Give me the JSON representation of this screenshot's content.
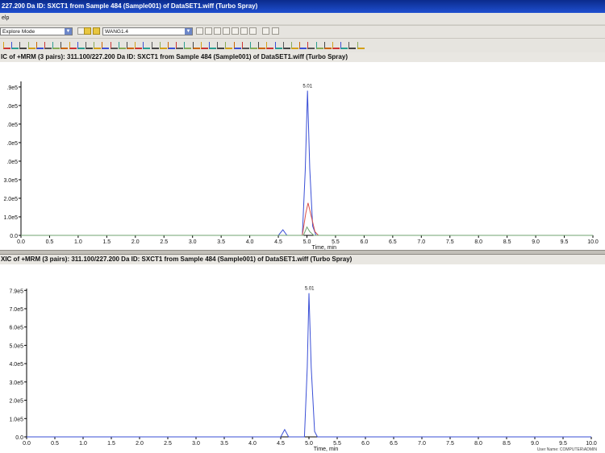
{
  "window": {
    "title": "227.200 Da ID: SXCT1 from Sample 484 (Sample001) of DataSET1.wiff (Turbo Spray)"
  },
  "menu": {
    "label": "elp"
  },
  "toolbar": {
    "mode_select": "Explore Mode",
    "dataset_select": "WANG1.4"
  },
  "panes": [
    {
      "title": "IC of +MRM (3 pairs): 311.100/227.200 Da ID: SXCT1 from Sample 484 (Sample001) of DataSET1.wiff (Turbo Spray)",
      "peak_label": "5.01"
    },
    {
      "title": "XIC of +MRM (3 pairs): 311.100/227.200 Da ID: SXCT1 from Sample 484 (Sample001) of DataSET1.wiff (Turbo Spray)",
      "peak_label": "5.01"
    }
  ],
  "status": {
    "user": "User Name: COMPUTER\\ADMIN"
  },
  "chart_data": [
    {
      "type": "line",
      "xlabel": "Time, min",
      "xlim": [
        0,
        10
      ],
      "ylim": [
        0,
        8.3
      ],
      "x_ticks": [
        "0.0",
        "0.5",
        "1.0",
        "1.5",
        "2.0",
        "2.5",
        "3.0",
        "3.5",
        "4.0",
        "4.5",
        "5.0",
        "5.5",
        "6.0",
        "6.5",
        "7.0",
        "7.5",
        "8.0",
        "8.5",
        "9.0",
        "9.5",
        "10.0"
      ],
      "y_ticks": [
        {
          "v": 0,
          "label": "0.0"
        },
        {
          "v": 1,
          "label": "1.0e5"
        },
        {
          "v": 2,
          "label": "2.0e5"
        },
        {
          "v": 3,
          "label": "3.0e5"
        },
        {
          "v": 4,
          "label": ".0e5"
        },
        {
          "v": 5,
          "label": ".0e5"
        },
        {
          "v": 6,
          "label": ".0e5"
        },
        {
          "v": 7,
          "label": ".0e5"
        },
        {
          "v": 8,
          "label": ".9e5"
        }
      ],
      "peak_label_x": 5.01,
      "series": [
        {
          "color": "#3a4fd6",
          "points": [
            [
              0,
              0
            ],
            [
              4.5,
              0
            ],
            [
              4.58,
              0.3
            ],
            [
              4.65,
              0
            ],
            [
              4.92,
              0
            ],
            [
              4.97,
              3.5
            ],
            [
              5.01,
              7.8
            ],
            [
              5.05,
              3.6
            ],
            [
              5.1,
              0.5
            ],
            [
              5.16,
              0
            ],
            [
              10,
              0
            ]
          ]
        },
        {
          "color": "#d8504a",
          "points": [
            [
              0,
              0
            ],
            [
              4.92,
              0
            ],
            [
              4.98,
              1.2
            ],
            [
              5.02,
              1.75
            ],
            [
              5.07,
              1.1
            ],
            [
              5.14,
              0.2
            ],
            [
              5.2,
              0
            ],
            [
              10,
              0
            ]
          ]
        },
        {
          "color": "#6fa36f",
          "points": [
            [
              0,
              0
            ],
            [
              4.94,
              0
            ],
            [
              5.0,
              0.45
            ],
            [
              5.05,
              0.2
            ],
            [
              5.12,
              0
            ],
            [
              10,
              0
            ]
          ]
        }
      ]
    },
    {
      "type": "line",
      "xlabel": "Time, min",
      "xlim": [
        0,
        10
      ],
      "ylim": [
        0,
        8.1
      ],
      "x_ticks": [
        "0.0",
        "0.5",
        "1.0",
        "1.5",
        "2.0",
        "2.5",
        "3.0",
        "3.5",
        "4.0",
        "4.5",
        "5.0",
        "5.5",
        "6.0",
        "6.5",
        "7.0",
        "7.5",
        "8.0",
        "8.5",
        "9.0",
        "9.5",
        "10.0"
      ],
      "y_ticks": [
        {
          "v": 0,
          "label": "0.0"
        },
        {
          "v": 1,
          "label": "1.0e5"
        },
        {
          "v": 2,
          "label": "2.0e5"
        },
        {
          "v": 3,
          "label": "3.0e5"
        },
        {
          "v": 4,
          "label": "4.0e5"
        },
        {
          "v": 5,
          "label": "5.0e5"
        },
        {
          "v": 6,
          "label": "6.0e5"
        },
        {
          "v": 7,
          "label": "7.0e5"
        },
        {
          "v": 8,
          "label": "7.9e5"
        }
      ],
      "peak_label_x": 5.01,
      "series": [
        {
          "color": "#3a4fd6",
          "points": [
            [
              0,
              0
            ],
            [
              4.5,
              0
            ],
            [
              4.57,
              0.4
            ],
            [
              4.64,
              0
            ],
            [
              4.92,
              0
            ],
            [
              4.97,
              3.8
            ],
            [
              5.0,
              7.85
            ],
            [
              5.04,
              3.8
            ],
            [
              5.1,
              0.3
            ],
            [
              5.15,
              0
            ],
            [
              10,
              0
            ]
          ]
        }
      ]
    }
  ]
}
